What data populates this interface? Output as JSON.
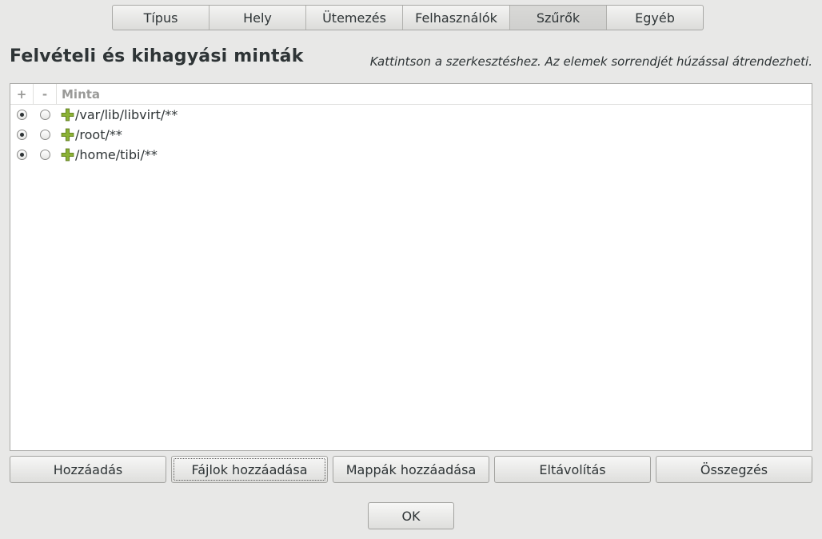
{
  "tabs": [
    {
      "label": "Típus",
      "active": false
    },
    {
      "label": "Hely",
      "active": false
    },
    {
      "label": "Ütemezés",
      "active": false
    },
    {
      "label": "Felhasználók",
      "active": false
    },
    {
      "label": "Szűrők",
      "active": true
    },
    {
      "label": "Egyéb",
      "active": false
    }
  ],
  "heading": "Felvételi és kihagyási minták",
  "hint": "Kattintson a szerkesztéshez. Az elemek sorrendjét húzással átrendezheti.",
  "list": {
    "columns": {
      "include": "+",
      "exclude": "-",
      "pattern": "Minta"
    },
    "rows": [
      {
        "include": true,
        "exclude": false,
        "icon": "plus-icon",
        "pattern": "/var/lib/libvirt/**"
      },
      {
        "include": true,
        "exclude": false,
        "icon": "plus-icon",
        "pattern": "/root/**"
      },
      {
        "include": true,
        "exclude": false,
        "icon": "plus-icon",
        "pattern": "/home/tibi/**"
      }
    ]
  },
  "buttons": {
    "add": "Hozzáadás",
    "add_files": "Fájlok hozzáadása",
    "add_folders": "Mappák hozzáadása",
    "remove": "Eltávolítás",
    "summary": "Összegzés"
  },
  "ok": "OK",
  "colors": {
    "background": "#e8e8e7",
    "include_icon": "#8ab135"
  }
}
